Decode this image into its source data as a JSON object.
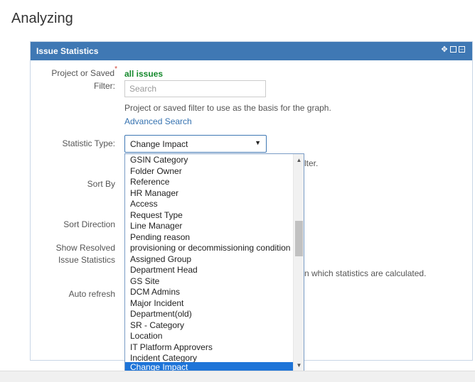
{
  "page": {
    "title": "Analyzing"
  },
  "panel": {
    "title": "Issue Statistics"
  },
  "form": {
    "project_label": "Project or Saved",
    "project_label2": "Filter:",
    "required_mark": "*",
    "project_value": "all issues",
    "search_placeholder": "Search",
    "project_help": "Project or saved filter to use as the basis for the graph.",
    "advanced_search": "Advanced Search",
    "stat_type_label": "Statistic Type:",
    "stat_type_value": "Change Impact",
    "stat_type_help_tail": "lter.",
    "sort_by_label": "Sort By",
    "sort_direction_label": "Sort Direction",
    "show_resolved_label": "Show Resolved",
    "show_resolved_label2": "Issue Statistics",
    "show_resolved_help_tail": "n which statistics are calculated.",
    "auto_refresh_label": "Auto refresh"
  },
  "dropdown": {
    "options": [
      "GSIN Category",
      "Folder Owner",
      "Reference",
      "HR Manager",
      "Access",
      "Request Type",
      "Line Manager",
      "Pending reason",
      "provisioning or decommissioning condition",
      "Assigned Group",
      "Department Head",
      "GS Site",
      "DCM Admins",
      "Major Incident",
      "Department(old)",
      "SR - Category",
      "Location",
      "IT Platform Approvers",
      "Incident Category",
      "Change Impact"
    ],
    "selected": "Change Impact"
  },
  "colors": {
    "header": "#3f78b4",
    "selected": "#1e74d8",
    "link": "#3572b0",
    "success": "#14892c"
  }
}
